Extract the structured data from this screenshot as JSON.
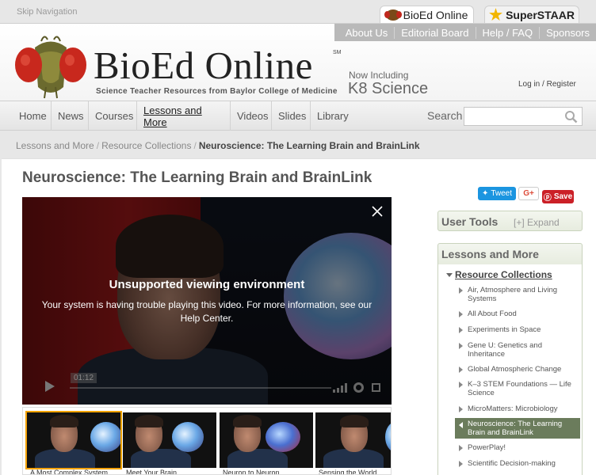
{
  "top": {
    "skip": "Skip Navigation",
    "portal_tabs": [
      "BioEd Online",
      "SuperSTAAR"
    ]
  },
  "header": {
    "utility_links": [
      "About Us",
      "Editorial Board",
      "Help / FAQ",
      "Sponsors"
    ],
    "logo_title": "BioEd Online",
    "logo_mark": "SM",
    "tagline": "Science Teacher Resources from Baylor College of Medicine",
    "now_including": "Now Including",
    "k8": "K8 Science",
    "login": "Log in",
    "login_sep": "/",
    "register": "Register"
  },
  "nav": {
    "items": [
      "Home",
      "News",
      "Courses",
      "Lessons and More",
      "Videos",
      "Slides",
      "Library"
    ],
    "active": "Lessons and More",
    "search_label": "Search",
    "search_value": ""
  },
  "breadcrumb": {
    "items": [
      "Lessons and More",
      "Resource Collections"
    ],
    "current": "Neuroscience: The Learning Brain and BrainLink"
  },
  "page": {
    "title": "Neuroscience: The Learning Brain and BrainLink"
  },
  "share": {
    "tweet": "Tweet",
    "gplus": "G+",
    "save": "Save"
  },
  "video": {
    "error_title": "Unsupported viewing environment",
    "error_message": "Your system is having trouble playing this video. For more information, see our Help Center.",
    "time": "01:12"
  },
  "thumbs": [
    {
      "caption": "A Most Complex System",
      "active": true
    },
    {
      "caption": "Meet Your Brain",
      "active": false
    },
    {
      "caption": "Neuron to Neuron",
      "active": false
    },
    {
      "caption": "Sensing the World",
      "active": false
    }
  ],
  "sidebar": {
    "user_tools": "User Tools",
    "expand": "[+] Expand",
    "lessons_title": "Lessons and More",
    "resource_collections": "Resource Collections",
    "items": [
      "Air, Atmosphere and Living Systems",
      "All About Food",
      "Experiments in Space",
      "Gene U: Genetics and Inheritance",
      "Global Atmospheric Change",
      "K–3 STEM Foundations — Life Science",
      "MicroMatters: Microbiology",
      "Neuroscience: The Learning Brain and BrainLink",
      "PowerPlay!",
      "Scientific Decision-making"
    ],
    "selected": "Neuroscience: The Learning Brain and BrainLink"
  },
  "colors": {
    "accent_green": "#6b7c5c",
    "tweet_blue": "#1b95e0",
    "pinterest_red": "#cb2027",
    "active_thumb": "#f5a300"
  }
}
